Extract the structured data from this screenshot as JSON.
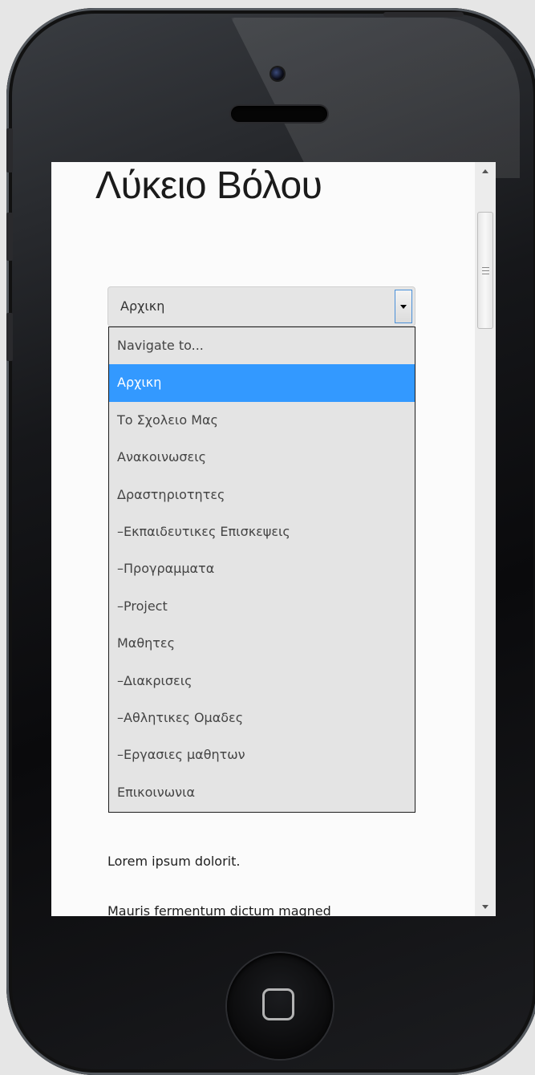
{
  "site": {
    "title": "Λύκειο Βόλου"
  },
  "nav_select": {
    "selected_value": "Αρχικη",
    "options": [
      "Navigate to...",
      "Αρχικη",
      "Το Σχολειο Μας",
      "Ανακοινωσεις",
      "Δραστηριοτητες",
      "–Εκπαιδευτικες Επισκεψεις",
      "–Προγραμματα",
      "–Project",
      "Μαθητες",
      "–Διακρισεις",
      "–Αθλητικες Ομαδες",
      "–Εργασιες μαθητων",
      "Επικοινωνια"
    ],
    "selected_index": 1
  },
  "content": {
    "paragraph_1": "Lorem ipsum dolorit.",
    "paragraph_2": "Mauris fermentum dictum magned"
  },
  "colors": {
    "selected_option_bg": "#3399ff",
    "dropdown_bg": "#e4e4e4",
    "phone_body": "#0a0a0c"
  },
  "icons": {
    "camera": "camera-icon",
    "home": "home-button-icon",
    "scroll_up": "arrow-up-icon",
    "scroll_down": "arrow-down-icon",
    "select_arrow": "chevron-down-icon"
  }
}
